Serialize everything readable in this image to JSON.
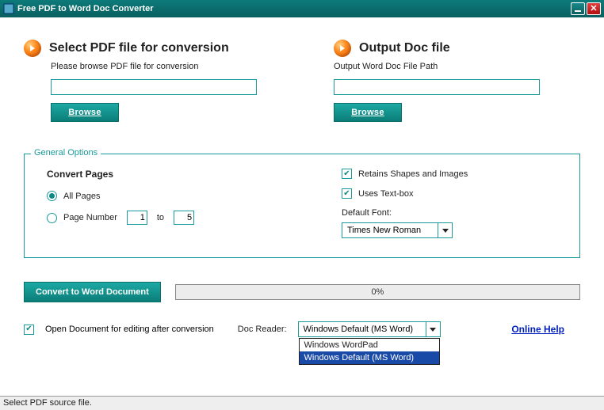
{
  "window": {
    "title": "Free PDF to Word Doc Converter"
  },
  "input_section": {
    "heading": "Select PDF file for conversion",
    "sub": "Please browse PDF file for conversion",
    "value": "",
    "browse": "Browse"
  },
  "output_section": {
    "heading": "Output Doc file",
    "sub": "Output Word Doc File Path",
    "value": "",
    "browse": "Browse"
  },
  "options": {
    "legend": "General Options",
    "pages_heading": "Convert Pages",
    "all_pages": "All Pages",
    "page_number_label": "Page Number",
    "page_from": "1",
    "page_to_label": "to",
    "page_to": "5",
    "retain_shapes": "Retains Shapes and Images",
    "uses_textbox": "Uses Text-box",
    "font_label": "Default Font:",
    "font_value": "Times New Roman"
  },
  "convert": {
    "button": "Convert to Word Document",
    "progress": "0%"
  },
  "footer": {
    "open_after": "Open Document for editing after conversion",
    "reader_label": "Doc Reader:",
    "reader_value": "Windows Default (MS Word)",
    "reader_options": [
      "Windows WordPad",
      "Windows Default (MS Word)"
    ],
    "reader_selected_index": 1,
    "online_help": "Online Help"
  },
  "statusbar": "Select PDF source file."
}
